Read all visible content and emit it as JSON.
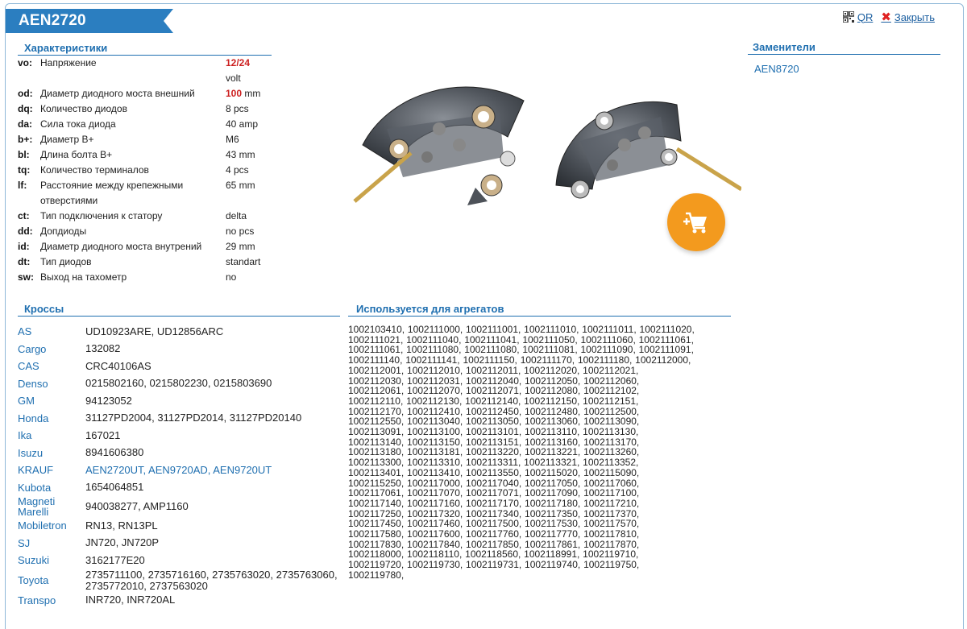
{
  "header": {
    "title": "AEN2720",
    "qr_label": "QR",
    "close_label": "Закрыть"
  },
  "specs": {
    "heading": "Характеристики",
    "rows": [
      {
        "code": "vo:",
        "name": "Напряжение",
        "value": "12/24",
        "unit": "",
        "highlight": true
      },
      {
        "code": "",
        "name": "",
        "value": "",
        "unit": "volt",
        "highlight": false
      },
      {
        "code": "od:",
        "name": "Диаметр диодного моста внешний",
        "value": "100",
        "unit": " mm",
        "highlight": true
      },
      {
        "code": "dq:",
        "name": "Количество диодов",
        "value": "8 pcs",
        "unit": "",
        "highlight": false
      },
      {
        "code": "da:",
        "name": "Сила тока диода",
        "value": "40 amp",
        "unit": "",
        "highlight": false
      },
      {
        "code": "b+:",
        "name": "Диаметр B+",
        "value": "M6",
        "unit": "",
        "highlight": false
      },
      {
        "code": "bl:",
        "name": "Длина болта B+",
        "value": "43 mm",
        "unit": "",
        "highlight": false
      },
      {
        "code": "tq:",
        "name": "Количество терминалов",
        "value": "4 pcs",
        "unit": "",
        "highlight": false
      },
      {
        "code": "lf:",
        "name": "Расстояние между крепежными отверстиями",
        "value": "65 mm",
        "unit": "",
        "highlight": false
      },
      {
        "code": "ct:",
        "name": "Тип подключения к статору",
        "value": "delta",
        "unit": "",
        "highlight": false
      },
      {
        "code": "dd:",
        "name": "Допдиоды",
        "value": "no pcs",
        "unit": "",
        "highlight": false
      },
      {
        "code": "id:",
        "name": "Диаметр диодного моста внутрений",
        "value": "29 mm",
        "unit": "",
        "highlight": false
      },
      {
        "code": "dt:",
        "name": "Тип диодов",
        "value": "standart",
        "unit": "",
        "highlight": false
      },
      {
        "code": "sw:",
        "name": "Выход на тахометр",
        "value": "no",
        "unit": "",
        "highlight": false
      }
    ]
  },
  "substitutes": {
    "heading": "Заменители",
    "items": [
      "AEN8720"
    ]
  },
  "cross": {
    "heading": "Кроссы",
    "rows": [
      {
        "brand": "AS",
        "nums": "UD10923ARE, UD12856ARC",
        "link": false
      },
      {
        "brand": "Cargo",
        "nums": "132082",
        "link": false
      },
      {
        "brand": "CAS",
        "nums": "CRC40106AS",
        "link": false
      },
      {
        "brand": "Denso",
        "nums": "0215802160, 0215802230, 0215803690",
        "link": false
      },
      {
        "brand": "GM",
        "nums": "94123052",
        "link": false
      },
      {
        "brand": "Honda",
        "nums": "31127PD2004, 31127PD2014, 31127PD20140",
        "link": false
      },
      {
        "brand": "Ika",
        "nums": "167021",
        "link": false
      },
      {
        "brand": "Isuzu",
        "nums": "8941606380",
        "link": false
      },
      {
        "brand": "KRAUF",
        "nums": "AEN2720UT, AEN9720AD, AEN9720UT",
        "link": true
      },
      {
        "brand": "Kubota",
        "nums": "1654064851",
        "link": false
      },
      {
        "brand": "Magneti Marelli",
        "nums": "940038277, AMP1160",
        "link": false
      },
      {
        "brand": "Mobiletron",
        "nums": "RN13, RN13PL",
        "link": false
      },
      {
        "brand": "SJ",
        "nums": "JN720, JN720P",
        "link": false
      },
      {
        "brand": "Suzuki",
        "nums": "3162177E20",
        "link": false
      },
      {
        "brand": "Toyota",
        "nums": "2735711100, 2735716160, 2735763020, 2735763060, 2735772010, 2737563020",
        "link": false
      },
      {
        "brand": "Transpo",
        "nums": "INR720, INR720AL",
        "link": false
      }
    ]
  },
  "used_for": {
    "heading": "Используется для агрегатов",
    "text": "1002103410, 1002111000, 1002111001, 1002111010, 1002111011, 1002111020, 1002111021, 1002111040, 1002111041, 1002111050, 1002111060, 1002111061, 1002111061, 1002111080, 1002111080, 1002111081, 1002111090, 1002111091, 1002111140, 1002111141, 1002111150, 1002111170, 1002111180, 1002112000, 1002112001, 1002112010, 1002112011, 1002112020, 1002112021, 1002112030, 1002112031, 1002112040, 1002112050, 1002112060, 1002112061, 1002112070, 1002112071, 1002112080, 1002112102, 1002112110, 1002112130, 1002112140, 1002112150, 1002112151, 1002112170, 1002112410, 1002112450, 1002112480, 1002112500, 1002112550, 1002113040, 1002113050, 1002113060, 1002113090, 1002113091, 1002113100, 1002113101, 1002113110, 1002113130, 1002113140, 1002113150, 1002113151, 1002113160, 1002113170, 1002113180, 1002113181, 1002113220, 1002113221, 1002113260, 1002113300, 1002113310, 1002113311, 1002113321, 1002113352, 1002113401, 1002113410, 1002113550, 1002115020, 1002115090, 1002115250, 1002117000, 1002117040, 1002117050, 1002117060, 1002117061, 1002117070, 1002117071, 1002117090, 1002117100, 1002117140, 1002117160, 1002117170, 1002117180, 1002117210, 1002117250, 1002117320, 1002117340, 1002117350, 1002117370, 1002117450, 1002117460, 1002117500, 1002117530, 1002117570, 1002117580, 1002117600, 1002117760, 1002117770, 1002117810, 1002117830, 1002117840, 1002117850, 1002117861, 1002117870, 1002118000, 1002118110, 1002118560, 1002118991, 1002119710, 1002119720, 1002119730, 1002119731, 1002119740, 1002119750, 1002119780,"
  },
  "colors": {
    "accent": "#2b7ec0",
    "link": "#1f6fb0",
    "highlight": "#cc2020",
    "cart": "#f39a1e"
  }
}
